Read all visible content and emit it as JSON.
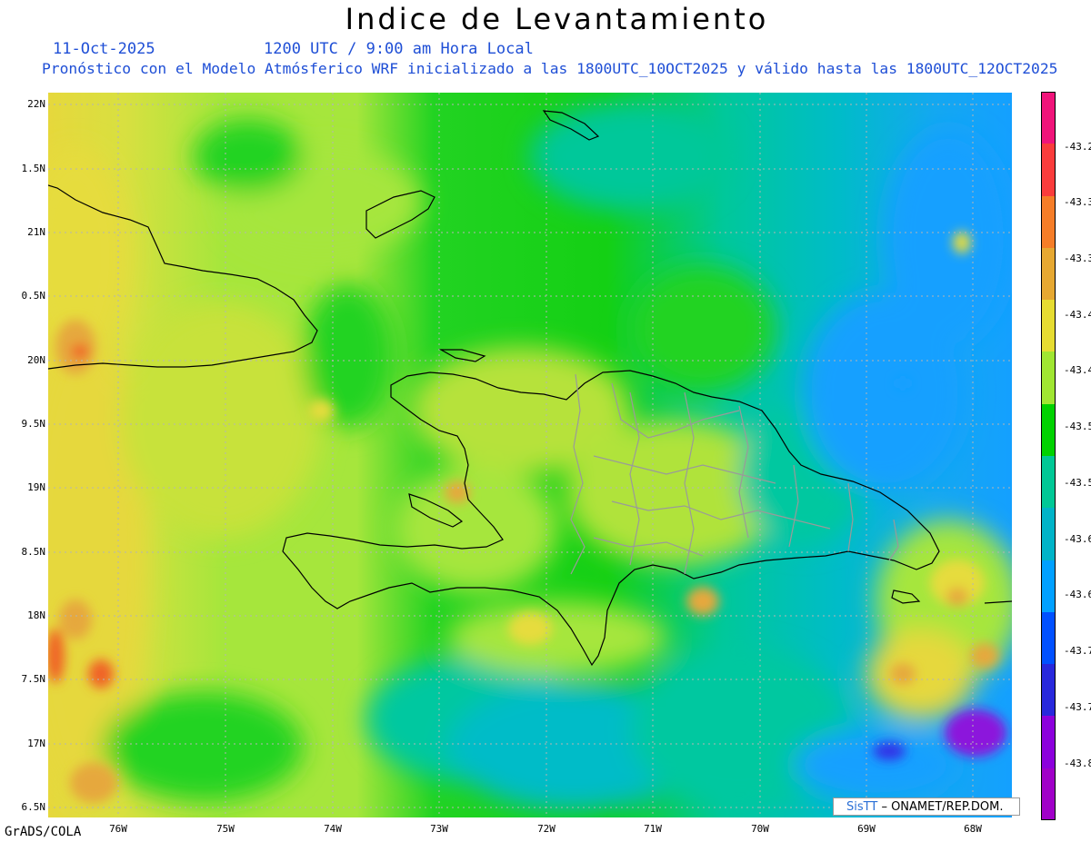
{
  "title": "Indice de Levantamiento",
  "date": "11-Oct-2025",
  "time_label": "1200 UTC / 9:00 am Hora Local",
  "forecast_text": "Pronóstico con el Modelo Atmósferico WRF inicializado a las 1800UTC_10OCT2025 y válido hasta las  1800UTC_12OCT2025",
  "credit": "GrADS/COLA",
  "logo": {
    "brand": "SisTT",
    "org": "– ONAMET/REP.DOM."
  },
  "lat_labels": [
    "22N",
    "1.5N",
    "21N",
    "0.5N",
    "20N",
    "9.5N",
    "19N",
    "8.5N",
    "18N",
    "7.5N",
    "17N",
    "6.5N"
  ],
  "lon_labels": [
    "76W",
    "75W",
    "74W",
    "73W",
    "72W",
    "71W",
    "70W",
    "69W",
    "68W"
  ],
  "colorbar": {
    "labels": [
      "-43.2",
      "-43.3",
      "-43.3",
      "-43.4",
      "-43.4",
      "-43.5",
      "-43.5",
      "-43.6",
      "-43.6",
      "-43.7",
      "-43.7",
      "-43.8"
    ],
    "colors": [
      "#f0147a",
      "#fa3c3c",
      "#f57d28",
      "#e6a832",
      "#e6dc32",
      "#a0e632",
      "#00d200",
      "#00c896",
      "#00b4c8",
      "#00a0ff",
      "#0050ff",
      "#2828dc",
      "#8c00dc",
      "#a000c8"
    ]
  },
  "palette": {
    "lime": "#a6e63c",
    "green": "#14d014",
    "teal": "#00c89a",
    "cyan": "#00b4d2",
    "blue": "#14a0ff",
    "yellow": "#e6dc3c",
    "orange": "#e6a83c",
    "red": "#f06428",
    "purple": "#9014dc",
    "coast": "#000000",
    "borders": "#9a9a9a",
    "text_blue": "#1f4fd6",
    "grid": "#b4b4b4"
  }
}
